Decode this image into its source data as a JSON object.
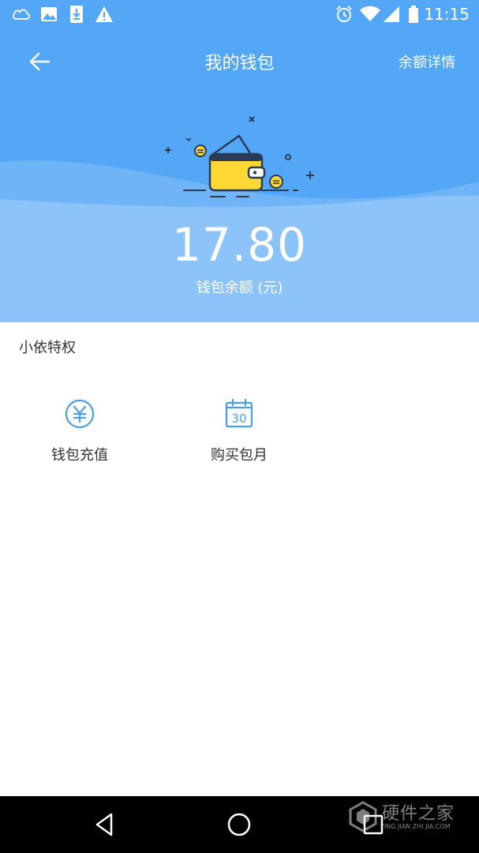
{
  "status_bar": {
    "time": "11:15",
    "left_icons": [
      "cloud-icon",
      "image-icon",
      "download-icon",
      "warning-icon"
    ],
    "right_icons": [
      "alarm-icon",
      "wifi-icon",
      "signal-icon",
      "battery-icon"
    ]
  },
  "topbar": {
    "title": "我的钱包",
    "detail_link": "余额详情",
    "back_icon": "back-arrow-icon"
  },
  "wallet": {
    "balance": "17.80",
    "balance_label": "钱包余额 (元)"
  },
  "privileges": {
    "section_title": "小依特权",
    "items": [
      {
        "label": "钱包充值",
        "icon": "yuan-circle-icon"
      },
      {
        "label": "购买包月",
        "icon": "calendar-icon",
        "icon_text": "30"
      }
    ]
  },
  "watermark": {
    "text": "硬件之家",
    "subtext": "YING JIAN ZHI JIA.COM"
  },
  "colors": {
    "header_blue": "#53a7f6",
    "light_blue": "#8cc3f9",
    "wave_blue": "#6fb4f7",
    "icon_blue": "#4a9eea",
    "wallet_yellow": "#fdd835"
  }
}
